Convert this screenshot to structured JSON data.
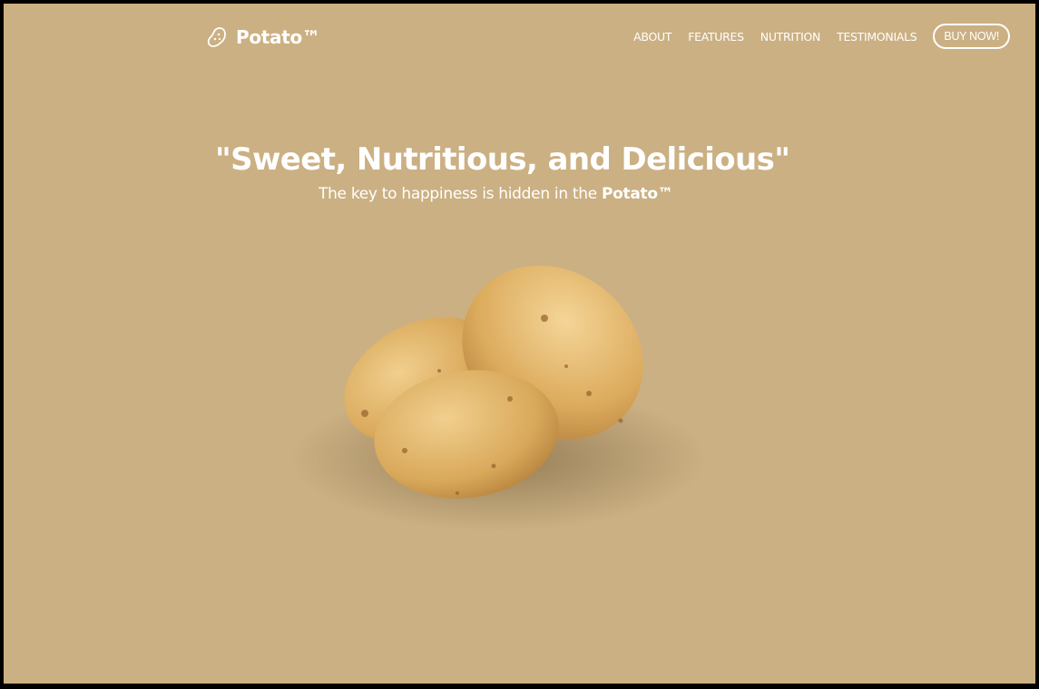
{
  "brand": {
    "name": "Potato™",
    "icon": "potato-icon"
  },
  "nav": {
    "items": [
      "ABOUT",
      "FEATURES",
      "NUTRITION",
      "TESTIMONIALS"
    ],
    "cta": "BUY NOW!"
  },
  "hero": {
    "headline": "\"Sweet, Nutritious, and Delicious\"",
    "subline_prefix": "The key to happiness is hidden in the ",
    "subline_bold": "Potato™"
  },
  "colors": {
    "background": "#cbb083",
    "text": "#ffffff"
  }
}
